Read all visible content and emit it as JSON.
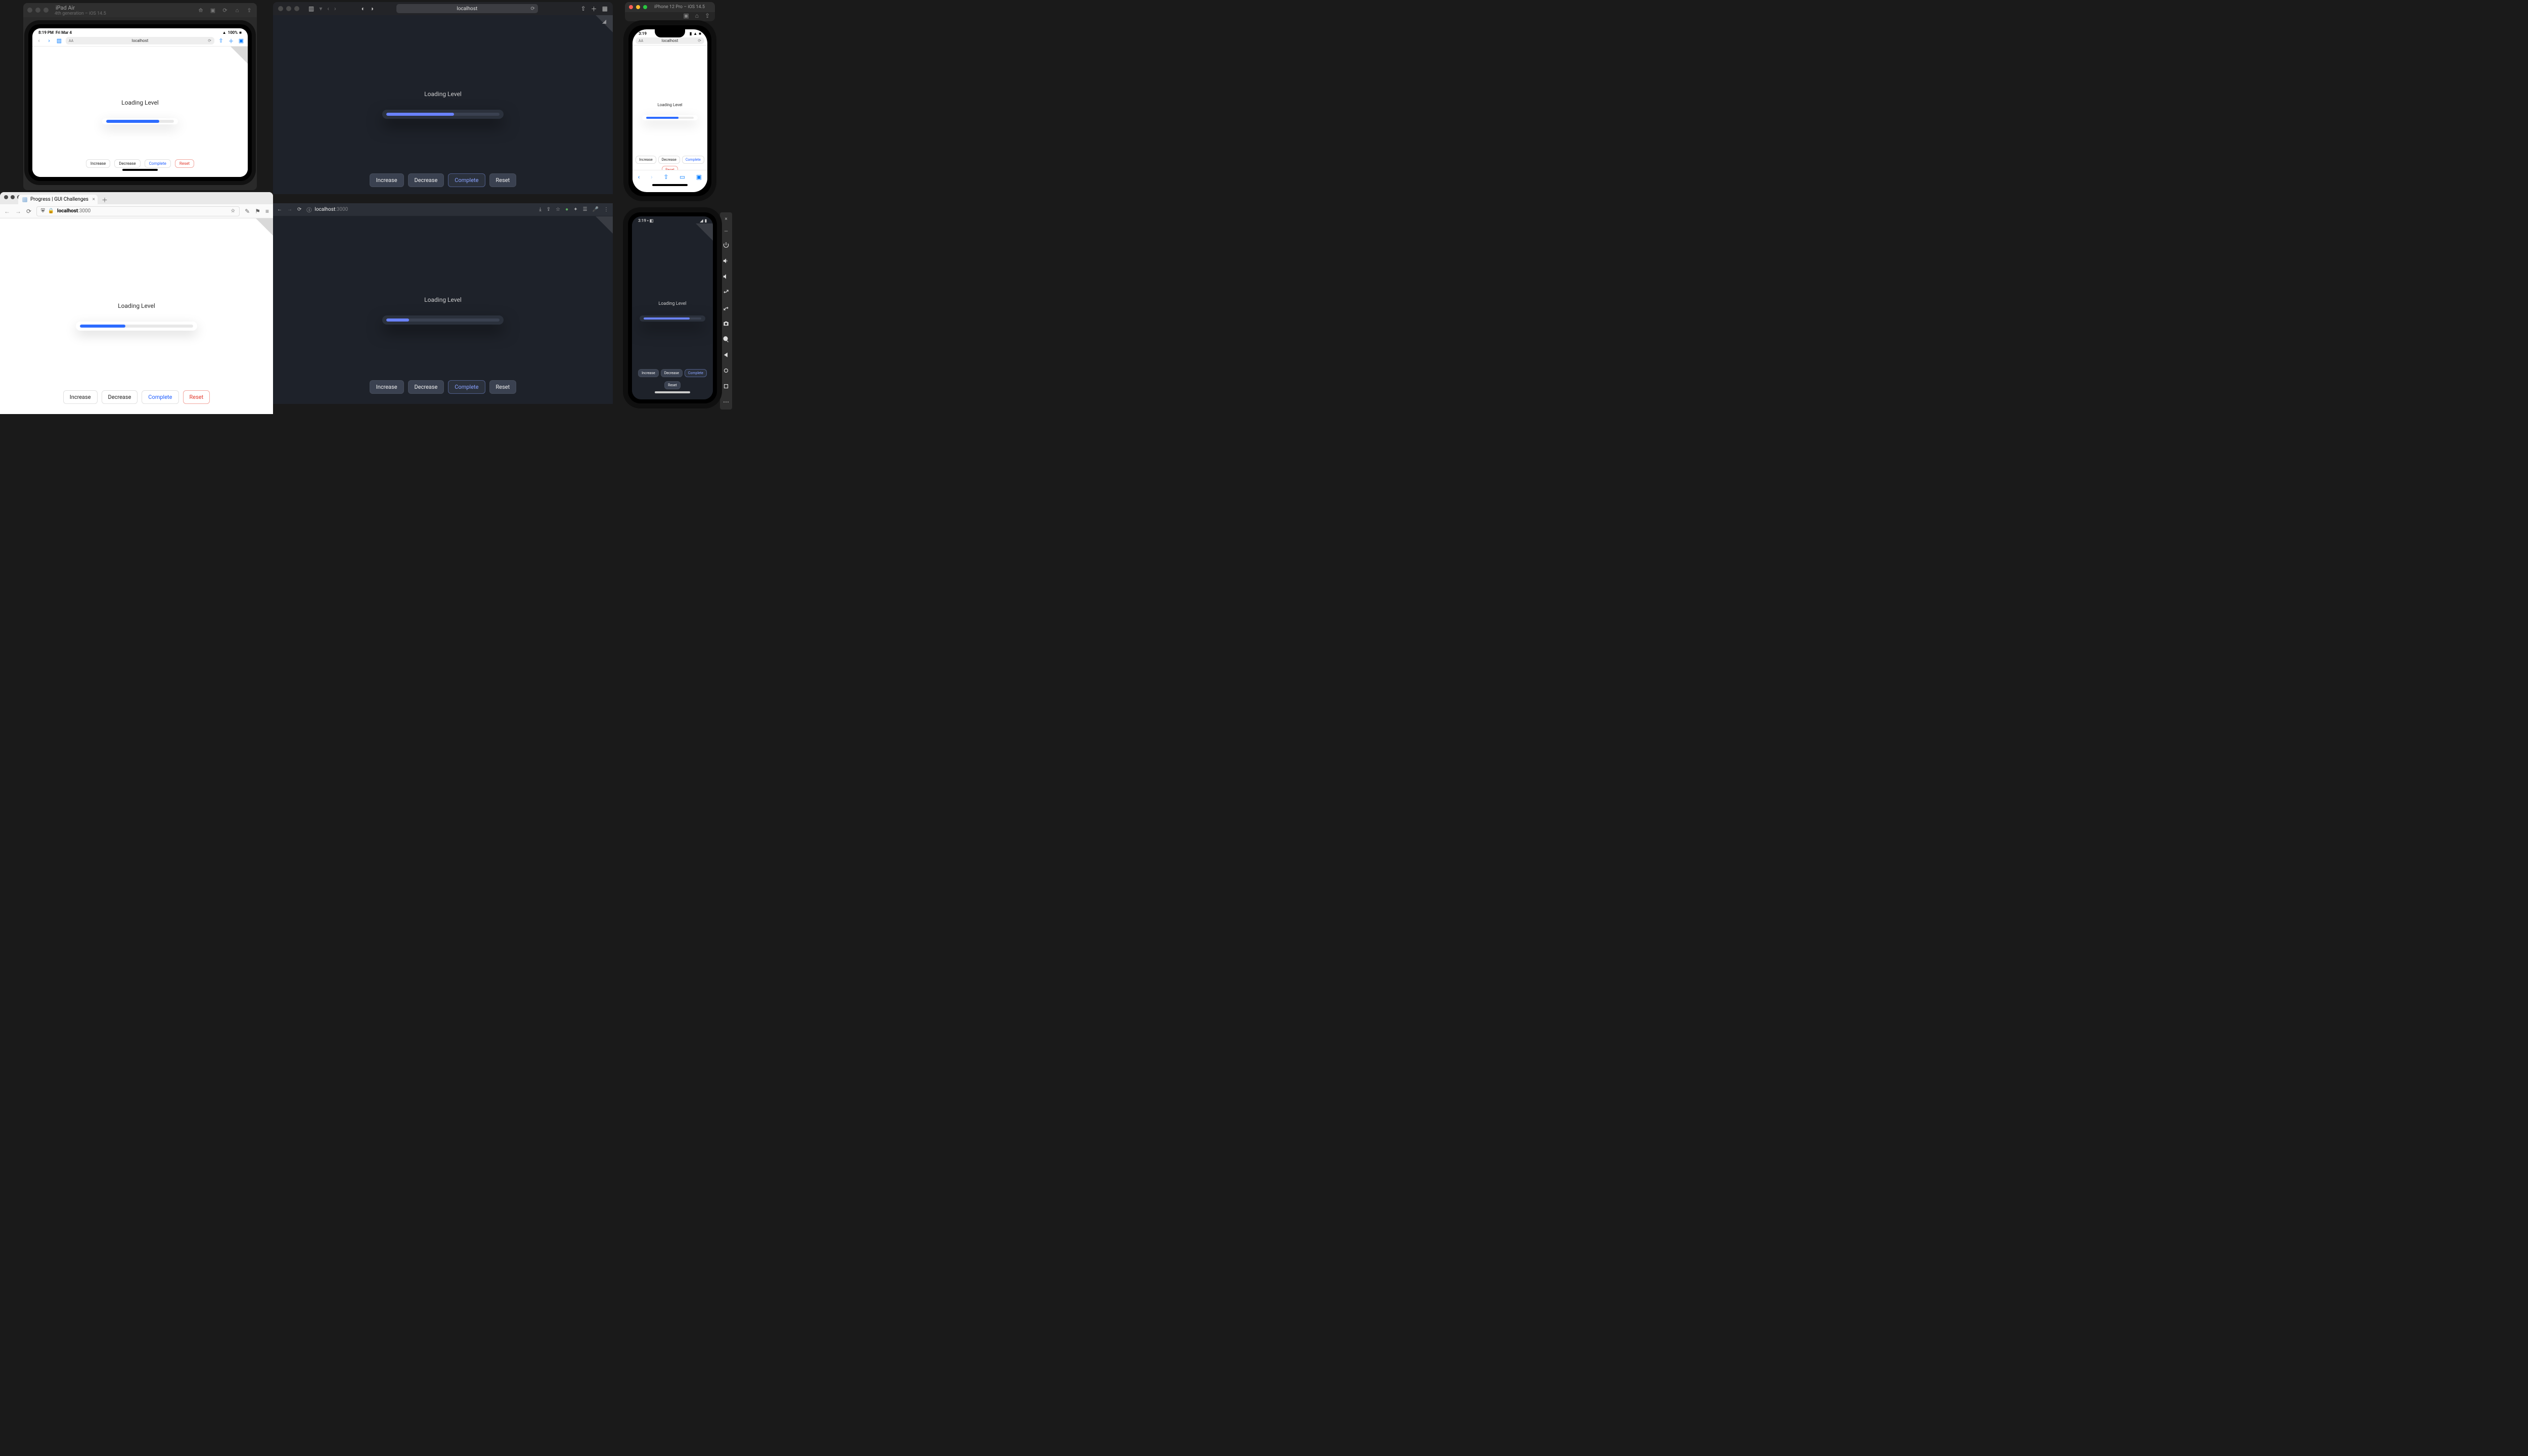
{
  "demo": {
    "label": "Loading Level",
    "buttons": {
      "increase": "Increase",
      "decrease": "Decrease",
      "complete": "Complete",
      "reset": "Reset"
    },
    "progress": {
      "ipad": 78,
      "safari_mac": 60,
      "firefox": 40,
      "chrome_dark": 20,
      "iphone": 68,
      "android": 80
    }
  },
  "ipad_sim": {
    "title": "iPad Air",
    "subtitle": "4th generation – iOS 14.5",
    "status": {
      "time": "8:19 PM",
      "date": "Fri Mar 4",
      "wifi": "wifi",
      "battery": "100%"
    },
    "url": "localhost"
  },
  "iphone_sim": {
    "title": "iPhone 12 Pro – iOS 14.5",
    "status": {
      "time": "3:19"
    },
    "url": "localhost"
  },
  "safari_mac": {
    "url": "localhost"
  },
  "firefox": {
    "tab_title": "Progress | GUI Challenges",
    "host": "localhost",
    "port": ":3000"
  },
  "chrome_dark": {
    "host": "localhost",
    "port": ":3000"
  },
  "android": {
    "status_time": "3:19",
    "label": "Loading Level"
  },
  "colors": {
    "light_accent": "#2c6bff",
    "dark_accent": "#6a82ff",
    "reset": "#e23b2e"
  }
}
